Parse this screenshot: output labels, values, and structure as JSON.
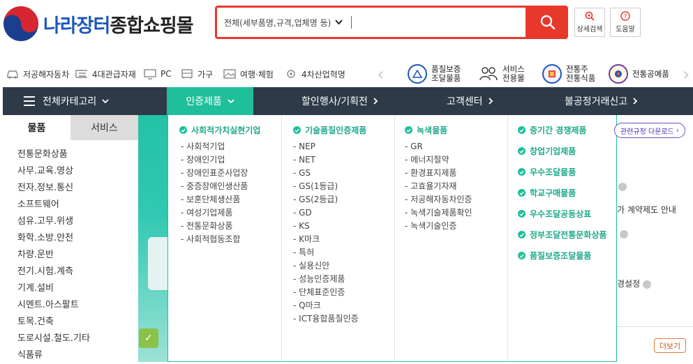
{
  "header": {
    "logo_text_blue": "나라장터",
    "logo_text_dark": "종합쇼핑몰",
    "search": {
      "scope": "전체(세부품명,규격,업체명 등)",
      "value": "",
      "placeholder": ""
    },
    "advanced_search_label": "상세검색",
    "help_label": "도움말"
  },
  "shortcuts": [
    {
      "label": "저공해자동차",
      "icon": "car-icon"
    },
    {
      "label": "4대관급자재",
      "icon": "materials-icon"
    },
    {
      "label": "PC",
      "icon": "monitor-icon"
    },
    {
      "label": "가구",
      "icon": "furniture-icon"
    },
    {
      "label": "여행·체험",
      "icon": "landscape-icon"
    },
    {
      "label": "4차산업혁명",
      "icon": "gear-network-icon"
    }
  ],
  "services": [
    {
      "line1": "품질보증",
      "line2": "조달물품",
      "color": "#1b57b8"
    },
    {
      "line1": "서비스",
      "line2": "전용몰",
      "color": "#333333"
    },
    {
      "line1": "전통주",
      "line2": "전통식품",
      "color": "#1b57b8"
    },
    {
      "line1": "전통공예품",
      "line2": "",
      "color": "#6a3fa0"
    }
  ],
  "nav": {
    "all_categories": "전체카테고리",
    "certified": "인증제품",
    "events": "할인행사/기획전",
    "customer": "고객센터",
    "report": "불공정거래신고"
  },
  "category_panel": {
    "tabs": [
      "물품",
      "서비스"
    ],
    "items": [
      "전통문화상품",
      "사무.교육.영상",
      "전자.정보.통신",
      "소프트웨어",
      "섬유.고무.위생",
      "화학.소방.안전",
      "차량.운반",
      "전기.시험.계측",
      "기계.설비",
      "시멘트.아스팔트",
      "토목.건축",
      "도로시설.철도.기타",
      "식품류"
    ]
  },
  "mega_menu": {
    "col1": {
      "title": "사회적가치실현기업",
      "items": [
        "사회적기업",
        "장애인기업",
        "장애인표준사업장",
        "중증장애인생산품",
        "보훈단체생산품",
        "여성기업제품",
        "전통문화상품",
        "사회적협동조합"
      ]
    },
    "col2": {
      "title": "기술품질인증제품",
      "items": [
        "NEP",
        "NET",
        "GS",
        "GS(1등급)",
        "GS(2등급)",
        "GD",
        "KS",
        "K마크",
        "특허",
        "실용신안",
        "성능인증제품",
        "단체표준인증",
        "Q마크",
        "ICT융합품질인증"
      ]
    },
    "col3": {
      "title": "녹색물품",
      "items": [
        "GR",
        "에너지절약",
        "환경표지제품",
        "고효율기자재",
        "저공해자동차인증",
        "녹색기술제품확인",
        "녹색기술인증"
      ]
    },
    "col4": {
      "items": [
        "중기간 경쟁제품",
        "창업기업제품",
        "우수조달물품",
        "학교구매물품",
        "우수조달공동상표",
        "정부조달전통문화상품",
        "품질보증조달물품"
      ]
    }
  },
  "right_area": {
    "rules_button": "관련규정 다운로드",
    "text1": "가 계약제도 안내",
    "text2": "경설정",
    "more_button": "더보기"
  }
}
